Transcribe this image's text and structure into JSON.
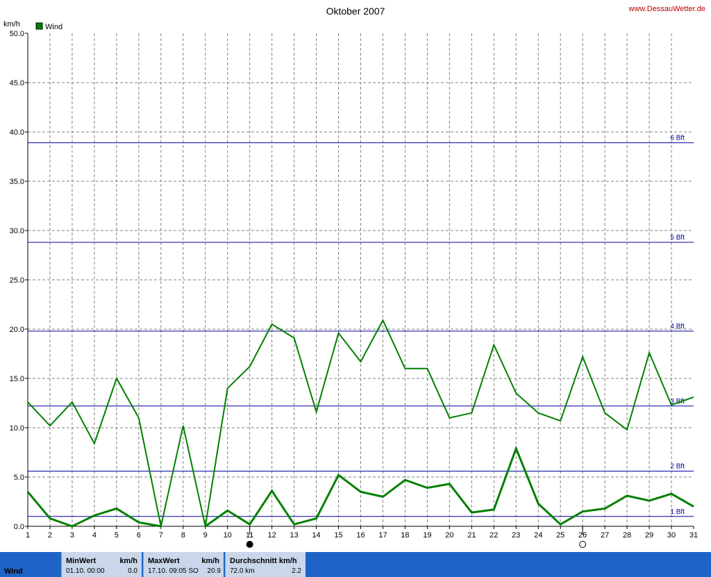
{
  "chart_data": {
    "type": "line",
    "title": "Oktober 2007",
    "source": "www.DessauWetter.de",
    "ylabel": "km/h",
    "ylim": [
      0,
      50
    ],
    "xlim": [
      1,
      31
    ],
    "yticks": [
      "0.0",
      "5.0",
      "10.0",
      "15.0",
      "20.0",
      "25.0",
      "30.0",
      "35.0",
      "40.0",
      "45.0",
      "50.0"
    ],
    "x": [
      1,
      2,
      3,
      4,
      5,
      6,
      7,
      8,
      9,
      10,
      11,
      12,
      13,
      14,
      15,
      16,
      17,
      18,
      19,
      20,
      21,
      22,
      23,
      24,
      25,
      26,
      27,
      28,
      29,
      30,
      31
    ],
    "legend": "Wind",
    "colors": {
      "series": "#008000",
      "beaufort": "#0000a0",
      "source": "#c00000"
    },
    "series": [
      {
        "name": "Wind",
        "values": [
          12.6,
          10.2,
          12.6,
          8.4,
          15.0,
          11.0,
          0.0,
          10.2,
          0.0,
          14.0,
          16.2,
          20.5,
          19.1,
          11.6,
          19.6,
          16.7,
          20.9,
          16.0,
          16.0,
          11.0,
          11.5,
          18.4,
          13.5,
          11.5,
          10.7,
          17.2,
          11.5,
          9.8,
          17.6,
          12.3,
          13.1
        ]
      },
      {
        "values": [
          3.5,
          0.8,
          0.0,
          1.1,
          1.8,
          0.4,
          0.0,
          null,
          0.0,
          1.6,
          0.2,
          3.6,
          0.2,
          0.8,
          5.2,
          3.5,
          3.0,
          4.7,
          3.9,
          4.3,
          1.4,
          1.7,
          7.9,
          2.3,
          0.2,
          1.5,
          1.8,
          3.1,
          2.6,
          3.3,
          2.0
        ]
      }
    ],
    "beaufort_lines": [
      {
        "label": "1 Bft",
        "value": 1.0
      },
      {
        "label": "2 Bft",
        "value": 5.6
      },
      {
        "label": "3 Bft",
        "value": 12.2
      },
      {
        "label": "4 Bft",
        "value": 19.8
      },
      {
        "label": "5 Bft",
        "value": 28.8
      },
      {
        "label": "6 Bft",
        "value": 38.9
      }
    ],
    "moon_phases": [
      {
        "day": 11,
        "phase": "new"
      },
      {
        "day": 26,
        "phase": "full"
      }
    ],
    "grid": true
  },
  "footer": {
    "row_label": "Wind",
    "min": {
      "header": "MinWert",
      "unit": "km/h",
      "when": "01.10.  00:00",
      "value": "0.0"
    },
    "max": {
      "header": "MaxWert",
      "unit": "km/h",
      "when": "17.10.  09:05 SO",
      "value": "20.9"
    },
    "avg": {
      "header": "Durchschnitt km/h",
      "when": "72.0 km",
      "value": "2.2"
    }
  }
}
